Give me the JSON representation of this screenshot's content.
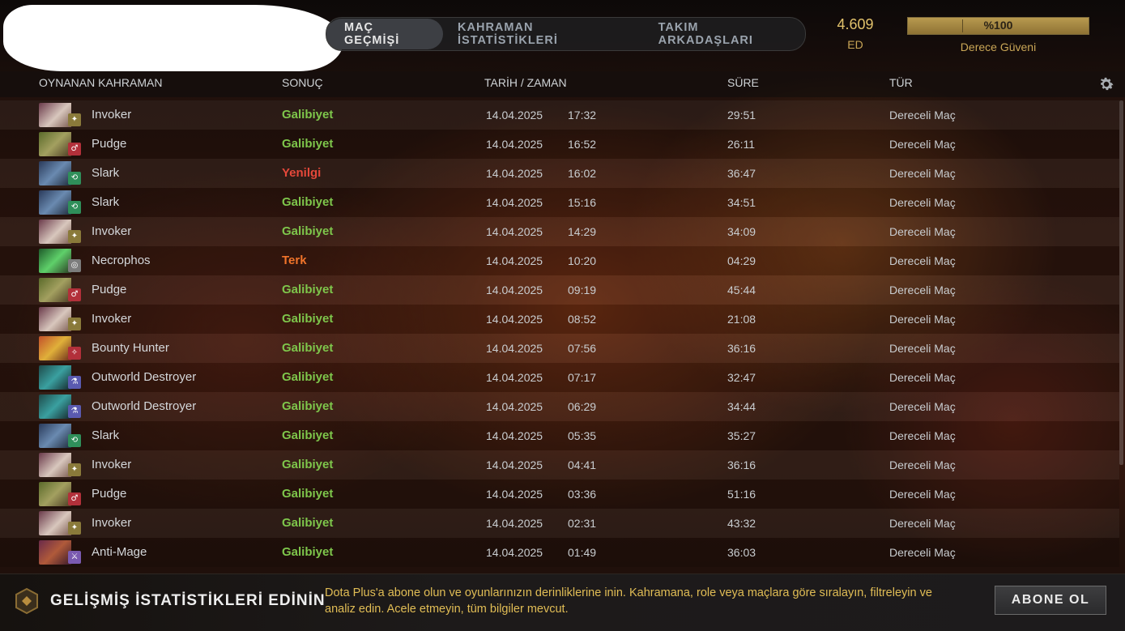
{
  "tabs": [
    {
      "label": "MAÇ GEÇMİŞİ",
      "active": true
    },
    {
      "label": "KAHRAMAN İSTATİSTİKLERİ",
      "active": false
    },
    {
      "label": "TAKIM ARKADAŞLARI",
      "active": false
    }
  ],
  "rating": {
    "value": "4.609",
    "label": "ED"
  },
  "confidence": {
    "text": "%100",
    "label": "Derece Güveni",
    "percent": 100
  },
  "columns": {
    "hero": "OYNANAN KAHRAMAN",
    "result": "SONUÇ",
    "datetime": "TARİH / ZAMAN",
    "duration": "SÜRE",
    "type": "TÜR"
  },
  "colors": {
    "win": "#7ec64b",
    "loss": "#e5483a",
    "abandon": "#f0742a",
    "gold": "#e2c26b"
  },
  "matches": [
    {
      "hero": "Invoker",
      "result": "Galibiyet",
      "outcome": "win",
      "date": "14.04.2025",
      "time": "17:32",
      "duration": "29:51",
      "type": "Dereceli Maç",
      "icon": "invoker"
    },
    {
      "hero": "Pudge",
      "result": "Galibiyet",
      "outcome": "win",
      "date": "14.04.2025",
      "time": "16:52",
      "duration": "26:11",
      "type": "Dereceli Maç",
      "icon": "pudge"
    },
    {
      "hero": "Slark",
      "result": "Yenilgi",
      "outcome": "loss",
      "date": "14.04.2025",
      "time": "16:02",
      "duration": "36:47",
      "type": "Dereceli Maç",
      "icon": "slark"
    },
    {
      "hero": "Slark",
      "result": "Galibiyet",
      "outcome": "win",
      "date": "14.04.2025",
      "time": "15:16",
      "duration": "34:51",
      "type": "Dereceli Maç",
      "icon": "slark"
    },
    {
      "hero": "Invoker",
      "result": "Galibiyet",
      "outcome": "win",
      "date": "14.04.2025",
      "time": "14:29",
      "duration": "34:09",
      "type": "Dereceli Maç",
      "icon": "invoker"
    },
    {
      "hero": "Necrophos",
      "result": "Terk",
      "outcome": "abandon",
      "date": "14.04.2025",
      "time": "10:20",
      "duration": "04:29",
      "type": "Dereceli Maç",
      "icon": "necrophos"
    },
    {
      "hero": "Pudge",
      "result": "Galibiyet",
      "outcome": "win",
      "date": "14.04.2025",
      "time": "09:19",
      "duration": "45:44",
      "type": "Dereceli Maç",
      "icon": "pudge"
    },
    {
      "hero": "Invoker",
      "result": "Galibiyet",
      "outcome": "win",
      "date": "14.04.2025",
      "time": "08:52",
      "duration": "21:08",
      "type": "Dereceli Maç",
      "icon": "invoker"
    },
    {
      "hero": "Bounty Hunter",
      "result": "Galibiyet",
      "outcome": "win",
      "date": "14.04.2025",
      "time": "07:56",
      "duration": "36:16",
      "type": "Dereceli Maç",
      "icon": "bounty-hunter"
    },
    {
      "hero": "Outworld Destroyer",
      "result": "Galibiyet",
      "outcome": "win",
      "date": "14.04.2025",
      "time": "07:17",
      "duration": "32:47",
      "type": "Dereceli Maç",
      "icon": "outworld-destroyer"
    },
    {
      "hero": "Outworld Destroyer",
      "result": "Galibiyet",
      "outcome": "win",
      "date": "14.04.2025",
      "time": "06:29",
      "duration": "34:44",
      "type": "Dereceli Maç",
      "icon": "outworld-destroyer"
    },
    {
      "hero": "Slark",
      "result": "Galibiyet",
      "outcome": "win",
      "date": "14.04.2025",
      "time": "05:35",
      "duration": "35:27",
      "type": "Dereceli Maç",
      "icon": "slark"
    },
    {
      "hero": "Invoker",
      "result": "Galibiyet",
      "outcome": "win",
      "date": "14.04.2025",
      "time": "04:41",
      "duration": "36:16",
      "type": "Dereceli Maç",
      "icon": "invoker"
    },
    {
      "hero": "Pudge",
      "result": "Galibiyet",
      "outcome": "win",
      "date": "14.04.2025",
      "time": "03:36",
      "duration": "51:16",
      "type": "Dereceli Maç",
      "icon": "pudge"
    },
    {
      "hero": "Invoker",
      "result": "Galibiyet",
      "outcome": "win",
      "date": "14.04.2025",
      "time": "02:31",
      "duration": "43:32",
      "type": "Dereceli Maç",
      "icon": "invoker"
    },
    {
      "hero": "Anti-Mage",
      "result": "Galibiyet",
      "outcome": "win",
      "date": "14.04.2025",
      "time": "01:49",
      "duration": "36:03",
      "type": "Dereceli Maç",
      "icon": "anti-mage"
    }
  ],
  "promo": {
    "title": "GELİŞMİŞ İSTATİSTİKLERİ EDİNİN",
    "description": "Dota Plus'a abone olun ve oyunlarınızın derinliklerine inin. Kahramana, role veya maçlara göre sıralayın, filtreleyin ve analiz edin. Acele etmeyin, tüm bilgiler mevcut.",
    "button": "ABONE OL"
  }
}
